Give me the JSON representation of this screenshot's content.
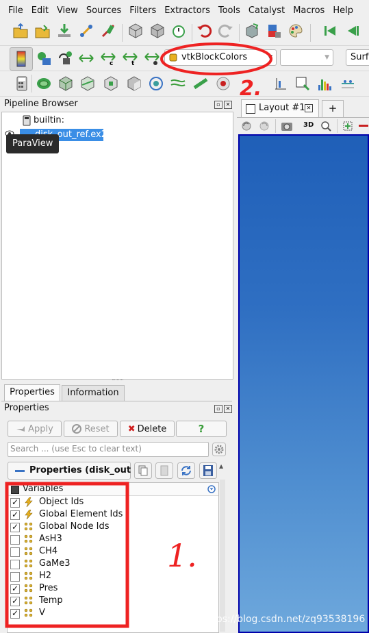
{
  "menu": [
    "File",
    "Edit",
    "View",
    "Sources",
    "Filters",
    "Extractors",
    "Tools",
    "Catalyst",
    "Macros",
    "Help"
  ],
  "toolbar2": {
    "color_by": "vtkBlockColors",
    "component": "",
    "representation": "Surfa"
  },
  "pipeline": {
    "title": "Pipeline Browser",
    "root": "builtin:",
    "source": "disk_out_ref.ex2",
    "tooltip": "ParaView"
  },
  "tabs": {
    "properties": "Properties",
    "information": "Information"
  },
  "properties": {
    "title": "Properties",
    "apply": "Apply",
    "reset": "Reset",
    "delete": "Delete",
    "help": "?",
    "search_placeholder": "Search ... (use Esc to clear text)",
    "section": "Properties (disk_out",
    "variables_header": "Variables",
    "variables": [
      {
        "name": "Object Ids",
        "checked": true,
        "icon": "lightning"
      },
      {
        "name": "Global Element Ids",
        "checked": true,
        "icon": "lightning"
      },
      {
        "name": "Global Node Ids",
        "checked": true,
        "icon": "points"
      },
      {
        "name": "AsH3",
        "checked": false,
        "icon": "points"
      },
      {
        "name": "CH4",
        "checked": false,
        "icon": "points"
      },
      {
        "name": "GaMe3",
        "checked": false,
        "icon": "points"
      },
      {
        "name": "H2",
        "checked": false,
        "icon": "points"
      },
      {
        "name": "Pres",
        "checked": true,
        "icon": "points"
      },
      {
        "name": "Temp",
        "checked": true,
        "icon": "points"
      },
      {
        "name": "V",
        "checked": true,
        "icon": "points"
      }
    ]
  },
  "layout": {
    "tab": "Layout #1",
    "add": "+",
    "mode_3d": "3D"
  },
  "annotations": {
    "one": "1.",
    "two": "2."
  },
  "watermark": "https://blog.csdn.net/zq93538196",
  "colors": {
    "annotation_red": "#ee2222",
    "selection_blue": "#3a8ee6",
    "view_blue": "#2a68bf"
  }
}
